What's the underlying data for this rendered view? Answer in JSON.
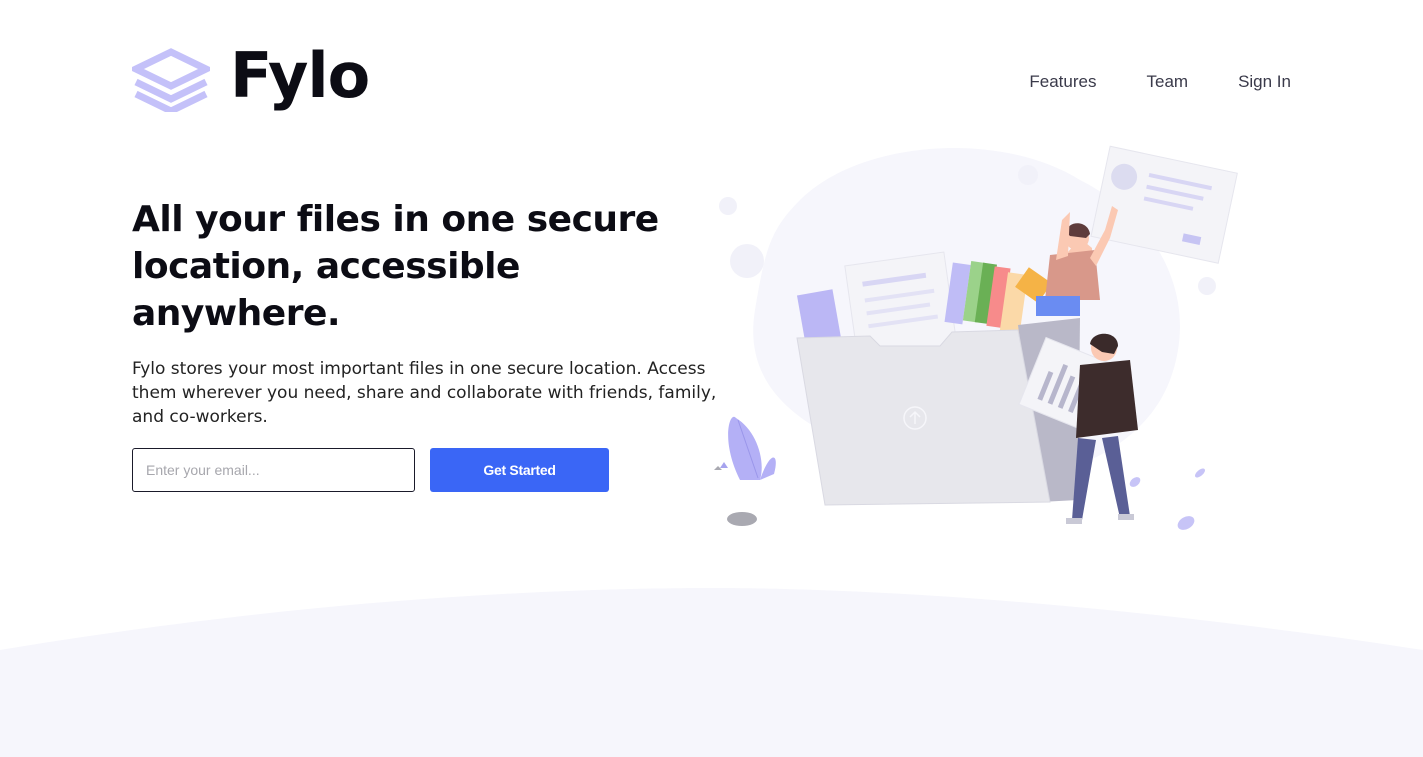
{
  "header": {
    "logo_text": "Fylo",
    "nav": [
      {
        "label": "Features"
      },
      {
        "label": "Team"
      },
      {
        "label": "Sign In"
      }
    ]
  },
  "hero": {
    "title": "All your files in one secure location, accessible anywhere.",
    "description": "Fylo stores your most important files in one secure location. Access them wherever you need, share and collaborate with friends, family, and co-workers.",
    "email_placeholder": "Enter your email...",
    "cta_label": "Get Started"
  },
  "colors": {
    "primary": "#3a66f6",
    "logo_accent": "#c4c1f9",
    "text_dark": "#0c0c14",
    "wave_bg": "#f6f6fc"
  }
}
